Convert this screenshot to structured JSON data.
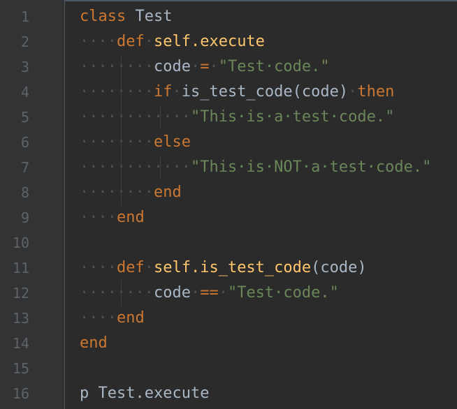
{
  "editor": {
    "lines": [
      {
        "num": "1",
        "indent": "",
        "tokens": [
          {
            "t": "class",
            "c": "kw"
          },
          {
            "t": " ",
            "c": "plain"
          },
          {
            "t": "Test",
            "c": "plain"
          }
        ]
      },
      {
        "num": "2",
        "indent": "····",
        "tokens": [
          {
            "t": "def",
            "c": "kw"
          },
          {
            "t": " ",
            "c": "plain"
          },
          {
            "t": "self.execute",
            "c": "fn"
          }
        ]
      },
      {
        "num": "3",
        "indent": "········",
        "tokens": [
          {
            "t": "code",
            "c": "plain"
          },
          {
            "t": " ",
            "c": "plain"
          },
          {
            "t": "=",
            "c": "kw"
          },
          {
            "t": " ",
            "c": "plain"
          },
          {
            "t": "\"Test code.\"",
            "c": "str"
          }
        ]
      },
      {
        "num": "4",
        "indent": "········",
        "tokens": [
          {
            "t": "if",
            "c": "kw"
          },
          {
            "t": " ",
            "c": "plain"
          },
          {
            "t": "is_test_code",
            "c": "plain"
          },
          {
            "t": "(code)",
            "c": "plain"
          },
          {
            "t": " ",
            "c": "plain"
          },
          {
            "t": "then",
            "c": "kw"
          }
        ]
      },
      {
        "num": "5",
        "indent": "············",
        "tokens": [
          {
            "t": "\"This is a test code.\"",
            "c": "str"
          }
        ]
      },
      {
        "num": "6",
        "indent": "········",
        "tokens": [
          {
            "t": "else",
            "c": "kw"
          }
        ]
      },
      {
        "num": "7",
        "indent": "············",
        "tokens": [
          {
            "t": "\"This is NOT a test code.\"",
            "c": "str"
          }
        ]
      },
      {
        "num": "8",
        "indent": "········",
        "tokens": [
          {
            "t": "end",
            "c": "kw"
          }
        ]
      },
      {
        "num": "9",
        "indent": "····",
        "tokens": [
          {
            "t": "end",
            "c": "kw"
          }
        ]
      },
      {
        "num": "10",
        "indent": "",
        "tokens": []
      },
      {
        "num": "11",
        "indent": "····",
        "tokens": [
          {
            "t": "def",
            "c": "kw"
          },
          {
            "t": " ",
            "c": "plain"
          },
          {
            "t": "self.is_test_code",
            "c": "fn"
          },
          {
            "t": "(code)",
            "c": "plain"
          }
        ]
      },
      {
        "num": "12",
        "indent": "········",
        "tokens": [
          {
            "t": "code",
            "c": "plain"
          },
          {
            "t": " ",
            "c": "plain"
          },
          {
            "t": "==",
            "c": "kw"
          },
          {
            "t": " ",
            "c": "plain"
          },
          {
            "t": "\"Test code.\"",
            "c": "str"
          }
        ]
      },
      {
        "num": "13",
        "indent": "····",
        "tokens": [
          {
            "t": "end",
            "c": "kw"
          }
        ]
      },
      {
        "num": "14",
        "indent": "",
        "tokens": [
          {
            "t": "end",
            "c": "kw"
          }
        ]
      },
      {
        "num": "15",
        "indent": "",
        "tokens": []
      },
      {
        "num": "16",
        "indent": "",
        "tokens": [
          {
            "t": "p",
            "c": "plain"
          },
          {
            "t": " ",
            "c": "plain"
          },
          {
            "t": "Test.execute",
            "c": "plain"
          }
        ]
      }
    ]
  },
  "colors": {
    "background": "#2b2b2b",
    "gutter": "#313335",
    "line_number": "#606366",
    "keyword": "#cc7832",
    "function": "#ffc66d",
    "string": "#6a8759",
    "identifier": "#a9b7c6",
    "whitespace_marker": "#4e5254"
  }
}
